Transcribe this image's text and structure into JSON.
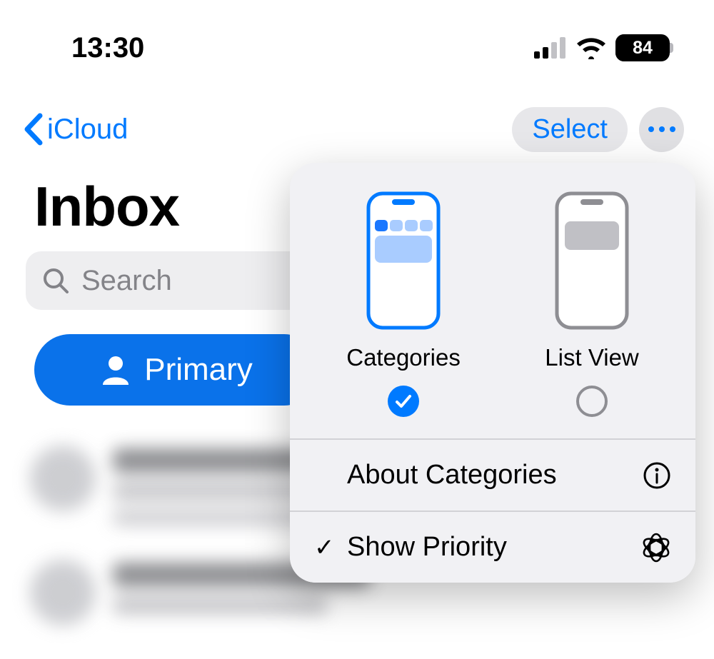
{
  "status": {
    "time": "13:30",
    "battery": "84"
  },
  "nav": {
    "back_label": "iCloud",
    "select_label": "Select"
  },
  "page": {
    "title": "Inbox",
    "search_placeholder": "Search"
  },
  "primary": {
    "label": "Primary"
  },
  "popover": {
    "view_categories_label": "Categories",
    "view_list_label": "List View",
    "about_label": "About Categories",
    "show_priority_label": "Show Priority",
    "show_priority_check": "✓"
  }
}
